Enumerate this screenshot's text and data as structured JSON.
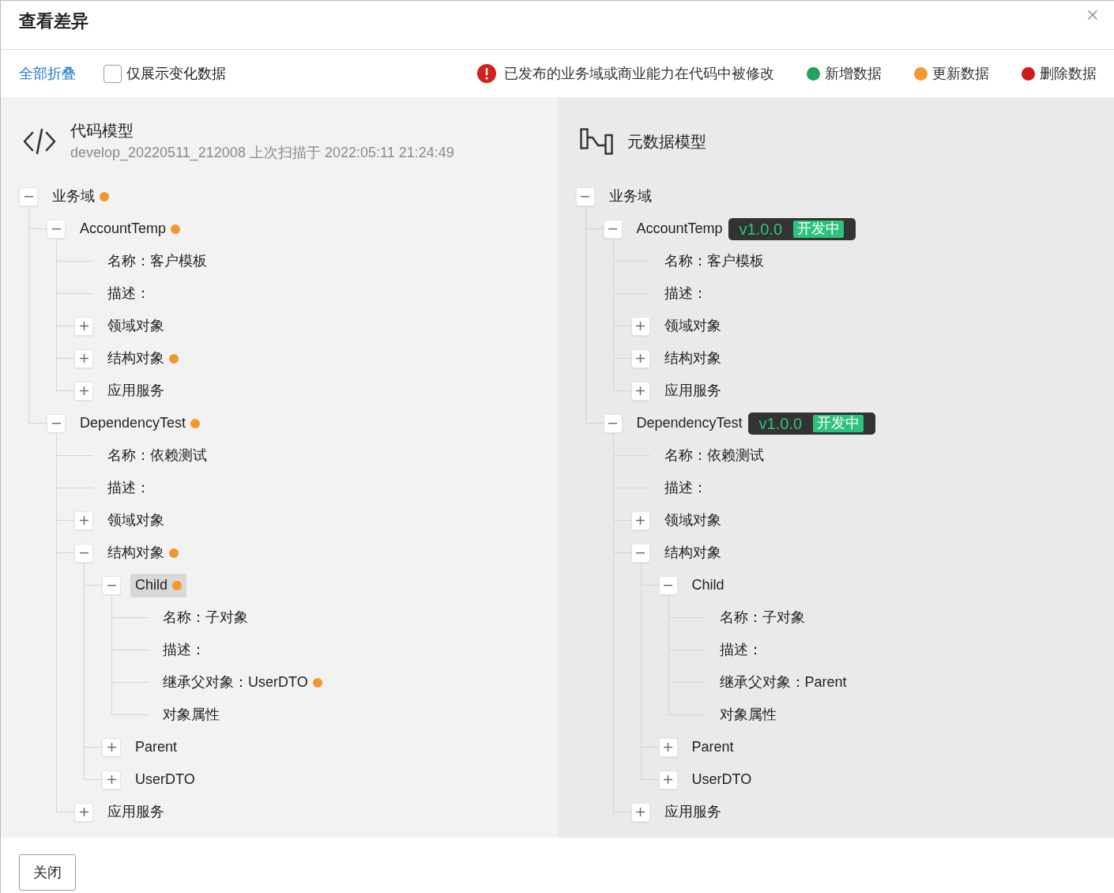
{
  "dialog": {
    "title": "查看差异"
  },
  "toolbar": {
    "collapse_all_link": "全部折叠",
    "only_changes": {
      "label": "仅展示变化数据",
      "checked": false
    },
    "legend": [
      {
        "kind": "warning",
        "label": "已发布的业务域或商业能力在代码中被修改"
      },
      {
        "kind": "dot",
        "color": "#1fa35f",
        "label": "新增数据"
      },
      {
        "kind": "dot",
        "color": "#f5982e",
        "label": "更新数据"
      },
      {
        "kind": "dot",
        "color": "#cf1a1a",
        "label": "删除数据"
      }
    ]
  },
  "panels": [
    {
      "kind": "code",
      "title": "代码模型",
      "subtitle": "develop_20220511_212008 上次扫描于 2022:05:11 21:24:49",
      "tree": [
        {
          "label": "业务域",
          "expanded": true,
          "selected": false,
          "color": "#f5962d",
          "children": [
            {
              "label": "AccountTemp",
              "expanded": true,
              "selected": false,
              "color": "#f5962d",
              "children": [
                {
                  "label": "名称：客户模板",
                  "selected": false
                },
                {
                  "label": "描述：",
                  "selected": false
                },
                {
                  "label": "领域对象",
                  "expanded": false,
                  "selected": false
                },
                {
                  "label": "结构对象",
                  "expanded": false,
                  "selected": false,
                  "color": "#f5962d"
                },
                {
                  "label": "应用服务",
                  "expanded": false,
                  "selected": false
                }
              ]
            },
            {
              "label": "DependencyTest",
              "expanded": true,
              "selected": false,
              "color": "#f5962d",
              "children": [
                {
                  "label": "名称：依赖测试",
                  "selected": false
                },
                {
                  "label": "描述：",
                  "selected": false
                },
                {
                  "label": "领域对象",
                  "expanded": false,
                  "selected": false
                },
                {
                  "label": "结构对象",
                  "expanded": true,
                  "selected": false,
                  "color": "#f5962d",
                  "children": [
                    {
                      "label": "Child",
                      "expanded": true,
                      "selected": true,
                      "color": "#f5962d",
                      "children": [
                        {
                          "label": "名称：子对象",
                          "selected": false
                        },
                        {
                          "label": "描述：",
                          "selected": false
                        },
                        {
                          "label": "继承父对象：UserDTO",
                          "selected": false,
                          "color": "#f5962d"
                        },
                        {
                          "label": "对象属性",
                          "selected": false
                        }
                      ]
                    },
                    {
                      "label": "Parent",
                      "expanded": false,
                      "selected": false
                    },
                    {
                      "label": "UserDTO",
                      "expanded": false,
                      "selected": false
                    }
                  ]
                },
                {
                  "label": "应用服务",
                  "expanded": false,
                  "selected": false
                }
              ]
            }
          ]
        }
      ]
    },
    {
      "kind": "metadata",
      "title": "元数据模型",
      "tree": [
        {
          "label": "业务域",
          "expanded": true,
          "selected": false,
          "children": [
            {
              "label": "AccountTemp",
              "expanded": true,
              "selected": false,
              "tag": {
                "version": "v1.0.0",
                "status": "开发中"
              },
              "children": [
                {
                  "label": "名称：客户模板",
                  "selected": false
                },
                {
                  "label": "描述：",
                  "selected": false
                },
                {
                  "label": "领域对象",
                  "expanded": false,
                  "selected": false
                },
                {
                  "label": "结构对象",
                  "expanded": false,
                  "selected": false
                },
                {
                  "label": "应用服务",
                  "expanded": false,
                  "selected": false
                }
              ]
            },
            {
              "label": "DependencyTest",
              "expanded": true,
              "selected": false,
              "tag": {
                "version": "v1.0.0",
                "status": "开发中"
              },
              "children": [
                {
                  "label": "名称：依赖测试",
                  "selected": false
                },
                {
                  "label": "描述：",
                  "selected": false
                },
                {
                  "label": "领域对象",
                  "expanded": false,
                  "selected": false
                },
                {
                  "label": "结构对象",
                  "expanded": true,
                  "selected": false,
                  "children": [
                    {
                      "label": "Child",
                      "expanded": true,
                      "selected": false,
                      "children": [
                        {
                          "label": "名称：子对象",
                          "selected": false
                        },
                        {
                          "label": "描述：",
                          "selected": false
                        },
                        {
                          "label": "继承父对象：Parent",
                          "selected": false
                        },
                        {
                          "label": "对象属性",
                          "selected": false
                        }
                      ]
                    },
                    {
                      "label": "Parent",
                      "expanded": false,
                      "selected": false
                    },
                    {
                      "label": "UserDTO",
                      "expanded": false,
                      "selected": false
                    }
                  ]
                },
                {
                  "label": "应用服务",
                  "expanded": false,
                  "selected": false
                }
              ]
            }
          ]
        }
      ]
    }
  ],
  "footer": {
    "close_button": "关闭"
  }
}
